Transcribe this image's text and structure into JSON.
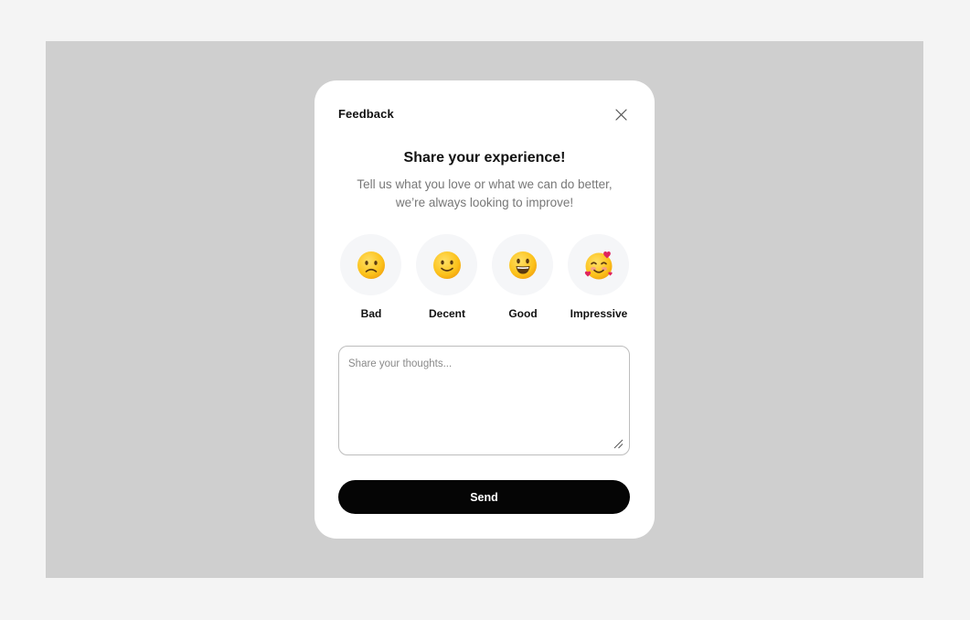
{
  "modal": {
    "title": "Feedback",
    "close_icon": "close-icon",
    "heading": "Share your experience!",
    "subtext_line1": "Tell us what you love or what we can do better,",
    "subtext_line2": "we’re always looking to improve!"
  },
  "ratings": [
    {
      "label": "Bad",
      "icon": "frowning-face-icon"
    },
    {
      "label": "Decent",
      "icon": "slightly-smiling-face-icon"
    },
    {
      "label": "Good",
      "icon": "grinning-face-icon"
    },
    {
      "label": "Impressive",
      "icon": "smiling-face-with-hearts-icon"
    }
  ],
  "comment": {
    "placeholder": "Share your thoughts...",
    "value": ""
  },
  "send": {
    "label": "Send"
  },
  "colors": {
    "page_bg": "#f4f4f4",
    "backdrop": "#cfcfcf",
    "modal_bg": "#ffffff",
    "emoji_circle_bg": "#f5f6f8",
    "button_bg": "#050505",
    "button_text": "#ffffff",
    "muted_text": "#777777"
  }
}
